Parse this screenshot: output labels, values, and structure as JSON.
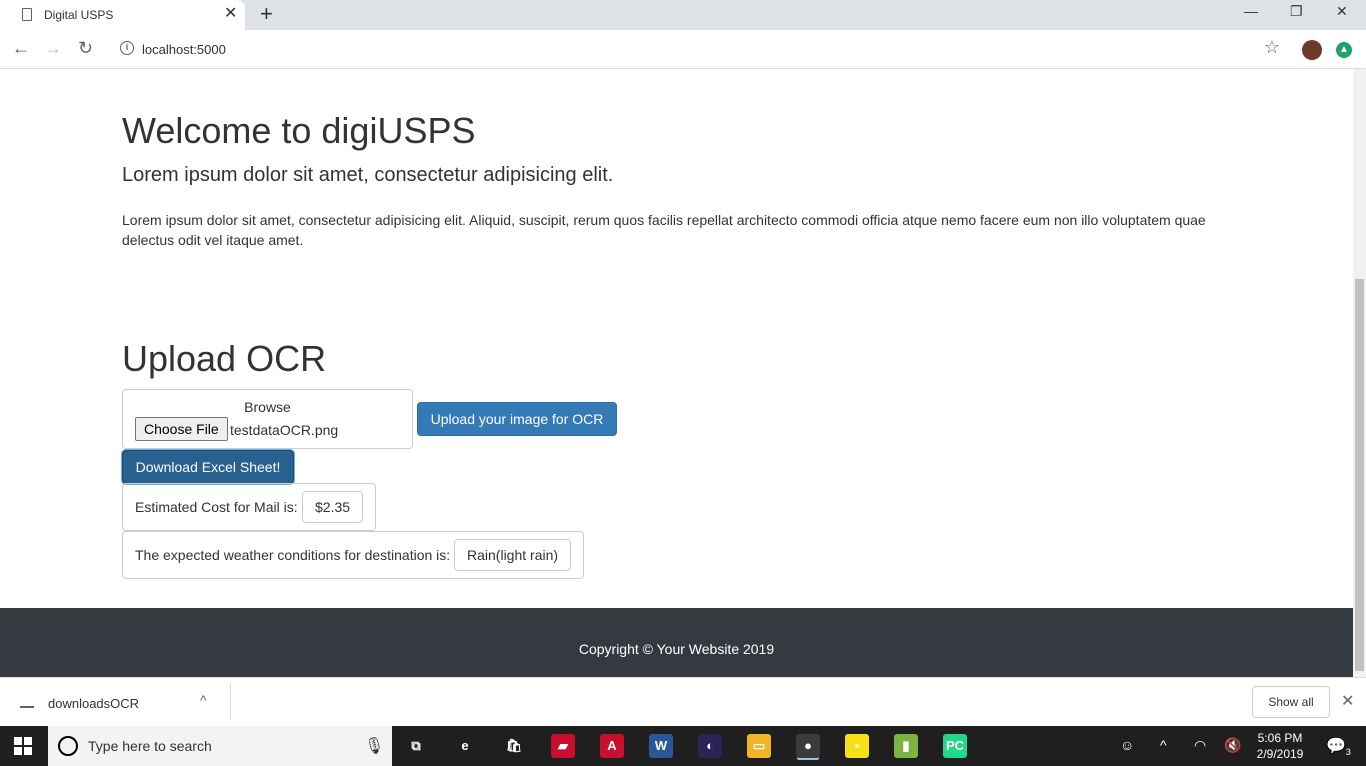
{
  "browser": {
    "tab_title": "Digital USPS",
    "tab_close": "✕",
    "new_tab": "+",
    "url": "localhost:5000",
    "window_controls": [
      "—",
      "❐",
      "✕"
    ],
    "nav": [
      "←",
      "→",
      "↻"
    ],
    "star": "☆"
  },
  "page": {
    "welcome_title": "Welcome to digiUSPS",
    "lead_text": "Lorem ipsum dolor sit amet, consectetur adipisicing elit.",
    "paragraph": "Lorem ipsum dolor sit amet, consectetur adipisicing elit. Aliquid, suscipit, rerum quos facilis repellat architecto commodi officia atque nemo facere eum non illo voluptatem quae delectus odit vel itaque amet.",
    "upload_title": "Upload OCR",
    "browse_label": "Browse",
    "choose_file_label": "Choose File",
    "selected_file": "testdataOCR.png",
    "upload_button": "Upload your image for OCR",
    "download_button": "Download Excel Sheet!",
    "cost_label": "Estimated Cost for Mail is:",
    "cost_value": "$2.35",
    "weather_label": "The expected weather conditions for destination is:",
    "weather_value": "Rain(light rain)",
    "footer_text": "Copyright © Your Website 2019"
  },
  "download_bar": {
    "file_name": "downloadsOCR",
    "show_all": "Show all",
    "close": "✕",
    "chevron": "^"
  },
  "taskbar": {
    "search_placeholder": "Type here to search",
    "time": "5:06 PM",
    "date": "2/9/2019",
    "notification_count": "3",
    "apps": [
      {
        "icon": "task-view-icon",
        "label": "⧉",
        "color": "#1f1f1f"
      },
      {
        "icon": "edge-icon",
        "label": "e",
        "color": "#1f1f1f"
      },
      {
        "icon": "store-icon",
        "label": "🛍",
        "color": "#1f1f1f"
      },
      {
        "icon": "reader-icon",
        "label": "▰",
        "color": "#c8102e"
      },
      {
        "icon": "acrobat-icon",
        "label": "A",
        "color": "#c8102e"
      },
      {
        "icon": "word-icon",
        "label": "W",
        "color": "#2b579a"
      },
      {
        "icon": "eclipse-icon",
        "label": "◐",
        "color": "#2c2255"
      },
      {
        "icon": "file-explorer-icon",
        "label": "▭",
        "color": "#f0b429"
      },
      {
        "icon": "chrome-icon",
        "label": "●",
        "color": "#3b3b3b"
      },
      {
        "icon": "sticky-notes-icon",
        "label": "▪",
        "color": "#f7e018"
      },
      {
        "icon": "chart-app-icon",
        "label": "▮",
        "color": "#7cb342"
      },
      {
        "icon": "pycharm-icon",
        "label": "PC",
        "color": "#21d789"
      }
    ]
  }
}
